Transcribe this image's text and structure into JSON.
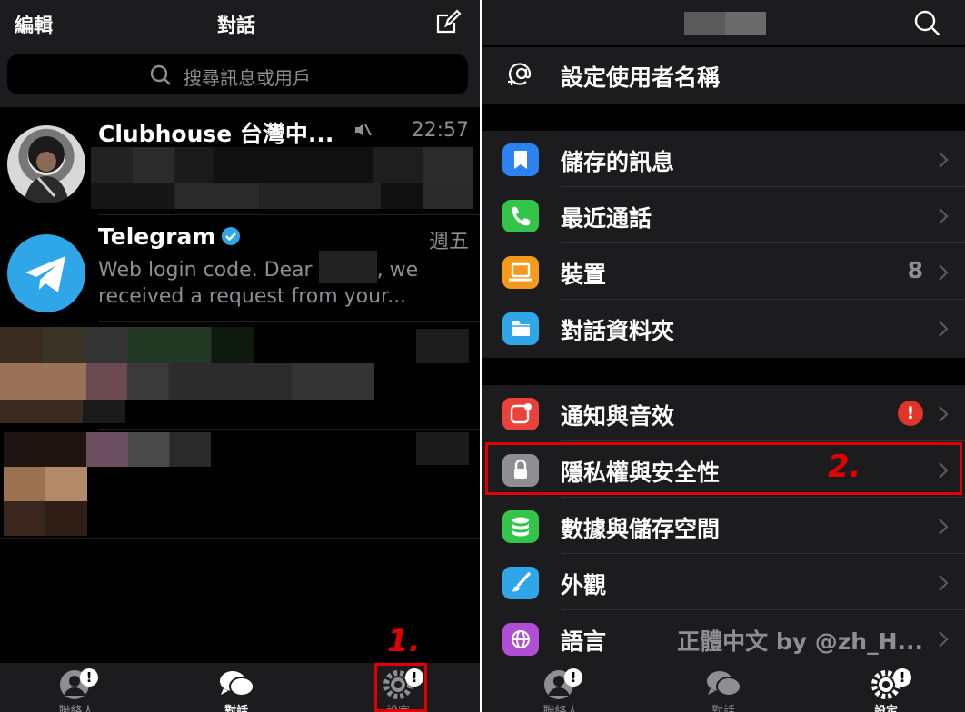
{
  "left": {
    "header": {
      "edit_label": "編輯",
      "title": "對話"
    },
    "search": {
      "placeholder": "搜尋訊息或用戶"
    },
    "chats": [
      {
        "name": "Clubhouse 台灣中...",
        "time": "22:57",
        "muted": true
      },
      {
        "name": "Telegram",
        "verified": true,
        "time": "週五",
        "line1_start": "Web login code. Dear ",
        "line1_end": ", we",
        "line2": "received a request from your..."
      }
    ],
    "tabs": [
      {
        "label": "聯絡人",
        "icon": "person-icon",
        "badge": "!"
      },
      {
        "label": "對話",
        "icon": "chat-bubbles-icon",
        "active": true
      },
      {
        "label": "設定",
        "icon": "gear-icon",
        "badge": "!"
      }
    ],
    "annotation": "1."
  },
  "right": {
    "username_label": "設定使用者名稱",
    "groups": [
      [
        {
          "label": "儲存的訊息",
          "icon": "bookmark-icon",
          "color": "#2b82f0"
        },
        {
          "label": "最近通話",
          "icon": "phone-icon",
          "color": "#33c54a"
        },
        {
          "label": "裝置",
          "icon": "laptop-icon",
          "color": "#f39a1c",
          "value": "8"
        },
        {
          "label": "對話資料夾",
          "icon": "folder-icon",
          "color": "#2fa6e8"
        }
      ],
      [
        {
          "label": "通知與音效",
          "icon": "notification-icon",
          "color": "#e8423a",
          "alert": "!"
        },
        {
          "label": "隱私權與安全性",
          "icon": "lock-icon",
          "color": "#8e8e93"
        },
        {
          "label": "數據與儲存空間",
          "icon": "database-icon",
          "color": "#33c54a"
        },
        {
          "label": "外觀",
          "icon": "brush-icon",
          "color": "#2fa6e8"
        },
        {
          "label": "語言",
          "icon": "globe-icon",
          "color": "#b04fd6",
          "value": "正體中文 by @zh_H..."
        }
      ]
    ],
    "tabs": [
      {
        "label": "聯絡人",
        "icon": "person-icon",
        "badge": "!"
      },
      {
        "label": "對話",
        "icon": "chat-bubbles-icon"
      },
      {
        "label": "設定",
        "icon": "gear-icon",
        "badge": "!",
        "active": true
      }
    ],
    "annotation": "2."
  },
  "colors": {
    "background": "#000000",
    "panel": "#1c1c1e",
    "secondary_text": "#8e8e93",
    "annotation_red": "#e00000",
    "telegram_blue": "#2fa6e8"
  }
}
